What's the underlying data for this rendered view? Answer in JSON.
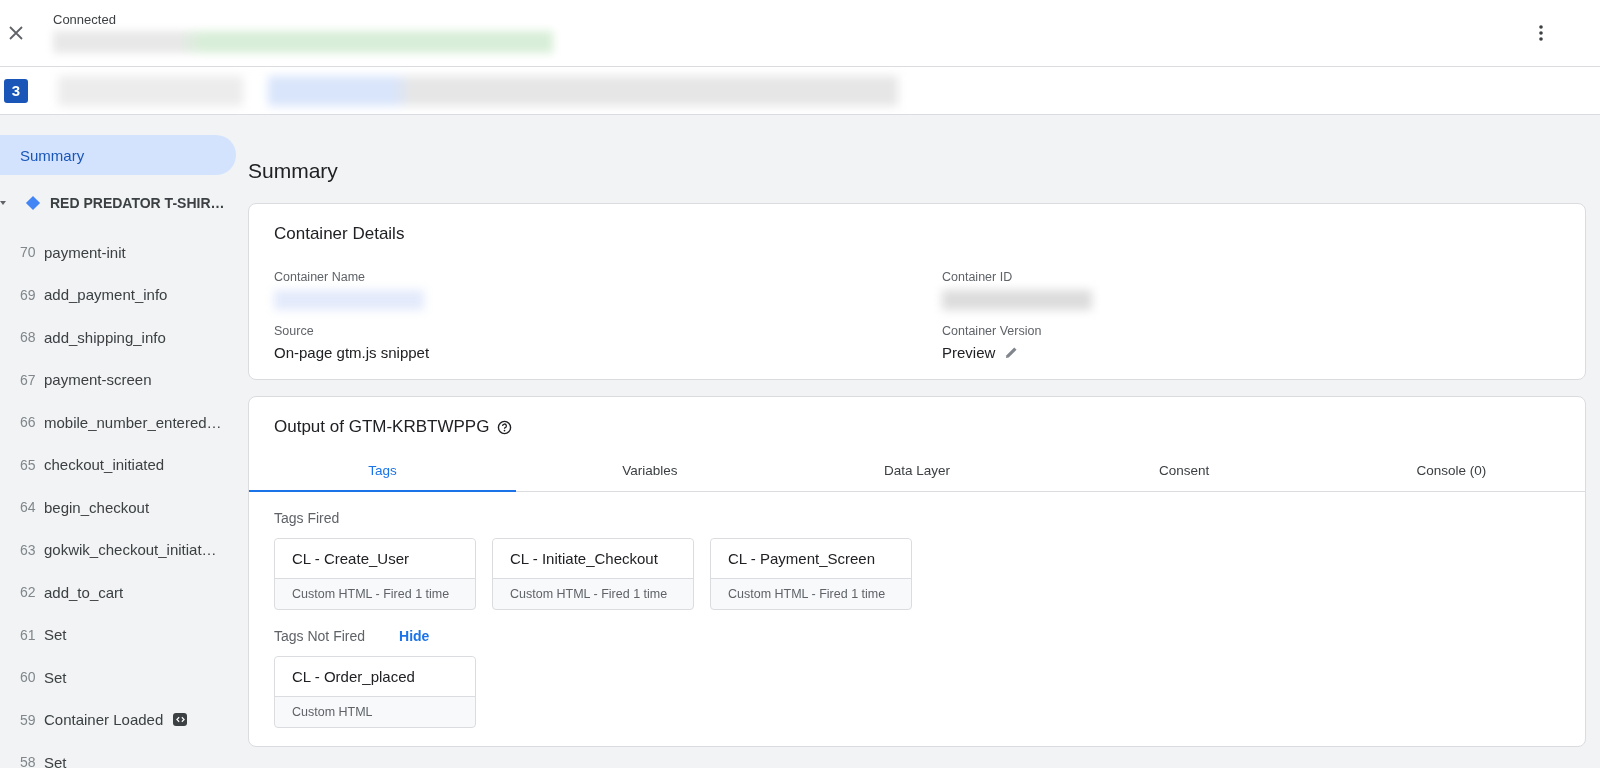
{
  "header": {
    "status": "Connected",
    "badge": "3"
  },
  "sidebar": {
    "items": [
      {
        "kind": "summary",
        "label": "Summary",
        "selected": true
      },
      {
        "kind": "page",
        "label": "RED PREDATOR T-SHIR…",
        "expanded": true,
        "children": [
          {
            "number": "70",
            "label": "payment-init"
          },
          {
            "number": "69",
            "label": "add_payment_info"
          },
          {
            "number": "68",
            "label": "add_shipping_info"
          },
          {
            "number": "67",
            "label": "payment-screen"
          },
          {
            "number": "66",
            "label": "mobile_number_entered…"
          },
          {
            "number": "65",
            "label": "checkout_initiated"
          },
          {
            "number": "64",
            "label": "begin_checkout"
          },
          {
            "number": "63",
            "label": "gokwik_checkout_initiat…"
          },
          {
            "number": "62",
            "label": "add_to_cart"
          },
          {
            "number": "61",
            "label": "Set"
          },
          {
            "number": "60",
            "label": "Set"
          },
          {
            "number": "59",
            "label": "Container Loaded",
            "code_icon": true
          },
          {
            "number": "58",
            "label": "Set"
          }
        ]
      }
    ]
  },
  "main": {
    "title": "Summary",
    "container_details": {
      "title": "Container Details",
      "fields": [
        {
          "label": "Container Name"
        },
        {
          "label": "Container ID"
        },
        {
          "label": "Source",
          "value": "On-page gtm.js snippet"
        },
        {
          "label": "Container Version",
          "value": "Preview",
          "editable": true
        }
      ]
    },
    "output": {
      "title": "Output of GTM-KRBTWPPG",
      "tabs": [
        {
          "label": "Tags",
          "selected": true
        },
        {
          "label": "Variables",
          "selected": false
        },
        {
          "label": "Data Layer",
          "selected": false
        },
        {
          "label": "Consent",
          "selected": false
        },
        {
          "label": "Console (0)",
          "selected": false
        }
      ],
      "sections": [
        {
          "title": "Tags Fired",
          "tags": [
            {
              "name": "CL - Create_User",
              "detail": "Custom HTML - Fired 1 time"
            },
            {
              "name": "CL - Initiate_Checkout",
              "detail": "Custom HTML - Fired 1 time"
            },
            {
              "name": "CL - Payment_Screen",
              "detail": "Custom HTML - Fired 1 time"
            }
          ]
        },
        {
          "title": "Tags Not Fired",
          "action": "Hide",
          "tags": [
            {
              "name": "CL - Order_placed",
              "detail": "Custom HTML"
            }
          ]
        }
      ]
    }
  }
}
